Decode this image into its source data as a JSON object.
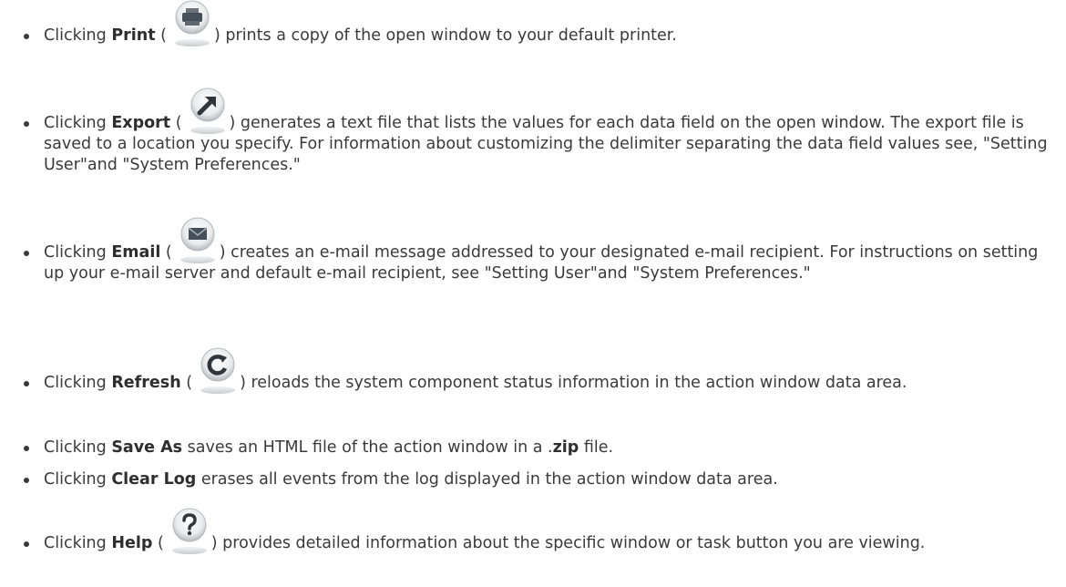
{
  "items": [
    {
      "pre": "Clicking ",
      "label": "Print",
      "open": " (",
      "close": ")",
      "rest": " prints a copy of the open window to your default printer.",
      "icon": "printer-icon"
    },
    {
      "pre": "Clicking ",
      "label": "Export",
      "open": " (",
      "close": ")",
      "rest": " generates a text file that lists the values for each data field on the open window. The export file is saved to a location you specify. For information about customizing the delimiter separating the data field values see, \"Setting User\"and \"System Preferences.\"",
      "icon": "export-arrow-icon"
    },
    {
      "pre": "Clicking ",
      "label": "Email",
      "open": " (",
      "close": ")",
      "rest": " creates an e-mail message addressed to your designated e-mail recipient. For instructions on setting up your e-mail server and default e-mail recipient, see \"Setting User\"and \"System Preferences.\"",
      "icon": "envelope-icon"
    },
    {
      "pre": "Clicking ",
      "label": "Refresh",
      "open": " (",
      "close": ")",
      "rest": " reloads the system component status information in the action window data area.",
      "icon": "refresh-icon"
    },
    {
      "pre": "Clicking ",
      "label": "Save As",
      "rest_a": " saves an HTML file of the action window in a .",
      "emph": "zip",
      "rest_b": " file."
    },
    {
      "pre": "Clicking ",
      "label": "Clear Log",
      "rest": " erases all events from the log displayed in the action window data area."
    },
    {
      "pre": "Clicking ",
      "label": "Help",
      "open": " (",
      "close": ")",
      "rest": " provides detailed information about the specific window or task button you are viewing.",
      "icon": "help-icon"
    }
  ]
}
